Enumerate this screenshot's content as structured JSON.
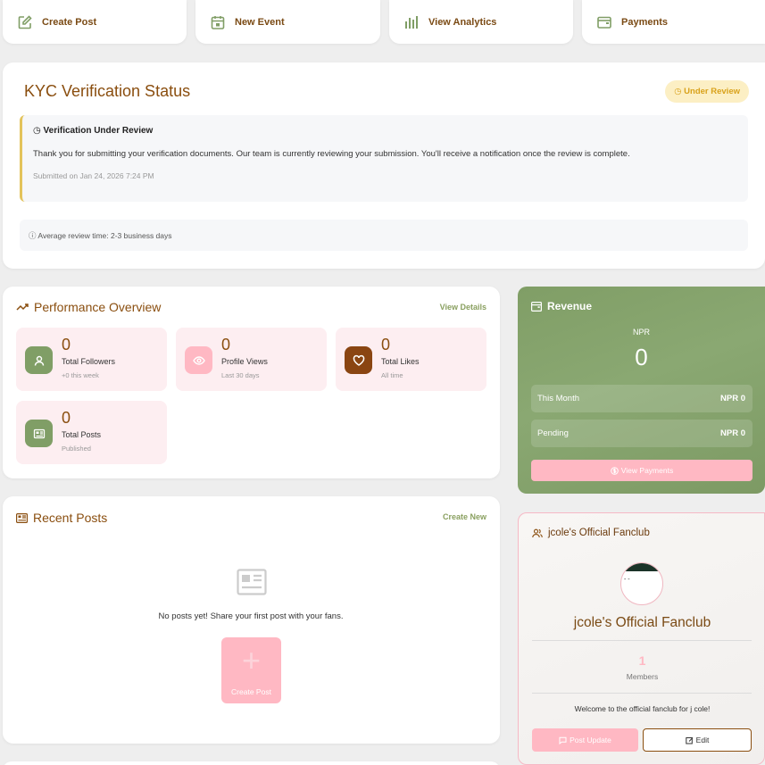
{
  "quick_actions": [
    {
      "label": "Create Post",
      "icon": "edit-icon"
    },
    {
      "label": "New Event",
      "icon": "calendar-icon"
    },
    {
      "label": "View Analytics",
      "icon": "bar-chart-icon"
    },
    {
      "label": "Payments",
      "icon": "wallet-icon"
    }
  ],
  "kyc": {
    "title": "KYC Verification Status",
    "badge": "Under Review",
    "notice_heading": "Verification Under Review",
    "notice_body": "Thank you for submitting your verification documents. Our team is currently reviewing your submission. You'll receive a notification once the review is complete.",
    "submitted": "Submitted on Jan 24, 2026 7:24 PM",
    "avg_time": "Average review time: 2-3 business days"
  },
  "performance": {
    "title": "Performance Overview",
    "link": "View Details",
    "stats": [
      {
        "value": "0",
        "label": "Total Followers",
        "sub": "+0 this week",
        "icon": "user-icon",
        "color": "#809e66"
      },
      {
        "value": "0",
        "label": "Profile Views",
        "sub": "Last 30 days",
        "icon": "eye-icon",
        "color": "#ffb8c3"
      },
      {
        "value": "0",
        "label": "Total Likes",
        "sub": "All time",
        "icon": "heart-icon",
        "color": "#8a4512"
      },
      {
        "value": "0",
        "label": "Total Posts",
        "sub": "Published",
        "icon": "newspaper-icon",
        "color": "#809e66"
      }
    ]
  },
  "recent_posts": {
    "title": "Recent Posts",
    "link": "Create New",
    "empty_text": "No posts yet! Share your first post with your fans.",
    "button_label": "Create Post",
    "button_glyph": "+"
  },
  "revenue": {
    "title": "Revenue",
    "currency": "NPR",
    "amount": "0",
    "rows": [
      {
        "label": "This Month",
        "value": "NPR 0"
      },
      {
        "label": "Pending",
        "value": "NPR 0"
      }
    ],
    "button": "View Payments"
  },
  "fanclub": {
    "header": "jcole's Official Fanclub",
    "avatar_text": "- -",
    "name": "jcole's Official Fanclub",
    "members_count": "1",
    "members_label": "Members",
    "welcome": "Welcome to the official fanclub for j cole!",
    "post_button": "Post Update",
    "edit_button": "Edit"
  }
}
